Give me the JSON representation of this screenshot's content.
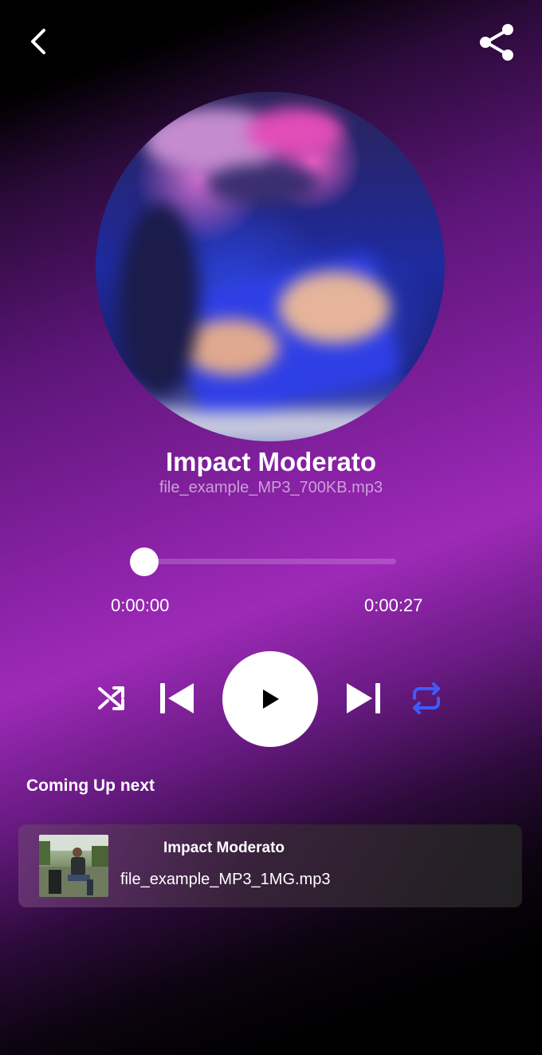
{
  "header": {
    "back_icon": "chevron-left-icon",
    "share_icon": "share-icon"
  },
  "now_playing": {
    "title": "Impact Moderato",
    "file": "file_example_MP3_700KB.mp3",
    "progress_fraction": 0,
    "time_current": "0:00:00",
    "time_total": "0:00:27"
  },
  "controls": {
    "shuffle_icon": "shuffle-icon",
    "previous_icon": "skip-previous-icon",
    "play_icon": "play-icon",
    "next_icon": "skip-next-icon",
    "repeat_icon": "repeat-icon",
    "repeat_color": "#3d5cff"
  },
  "up_next": {
    "label": "Coming Up next",
    "items": [
      {
        "title": "Impact Moderato",
        "file": "file_example_MP3_1MG.mp3"
      }
    ]
  }
}
